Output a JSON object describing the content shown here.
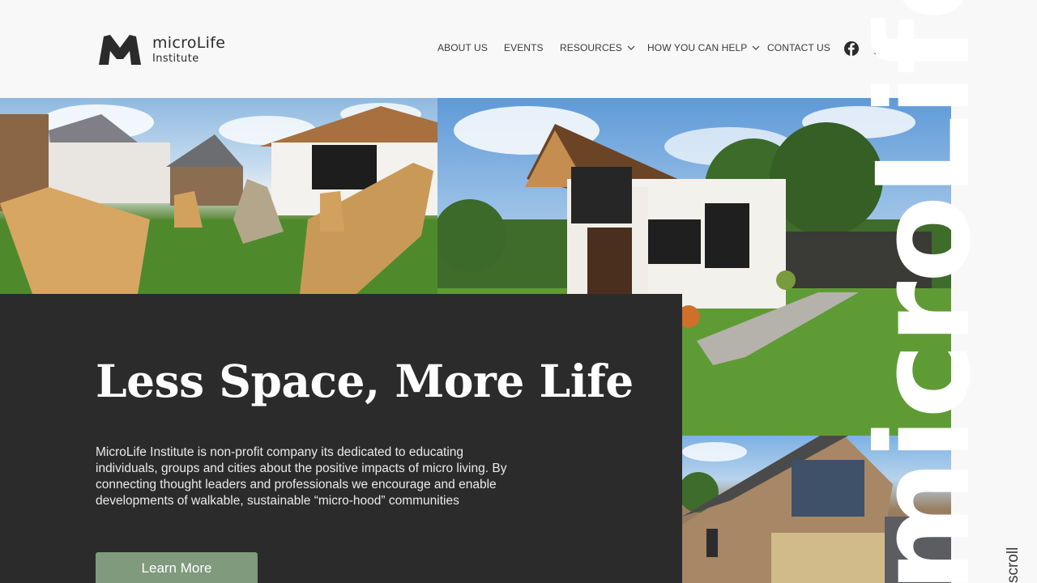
{
  "header": {
    "logo": {
      "line1": "microLife",
      "line2": "Institute",
      "brand_color": "#2b2b2b"
    },
    "nav": [
      {
        "label": "ABOUT US",
        "has_dropdown": false
      },
      {
        "label": "EVENTS",
        "has_dropdown": false
      },
      {
        "label": "RESOURCES",
        "has_dropdown": true
      },
      {
        "label": "HOW YOU CAN HELP",
        "has_dropdown": true
      },
      {
        "label": "CONTACT US",
        "has_dropdown": false
      }
    ],
    "social": [
      {
        "icon": "facebook-icon"
      },
      {
        "icon": "twitter-icon"
      },
      {
        "icon": "instagram-icon"
      },
      {
        "icon": "b-icon"
      }
    ]
  },
  "hero": {
    "headline": "Less Space, More Life",
    "intro": "MicroLife Institute is non-profit company its dedicated to educating individuals, groups and cities about the positive impacts of micro living. By connecting thought leaders and professionals we encourage and enable developments of walkable, sustainable “micro-hood” communities",
    "cta_label": "Learn More",
    "vertical_word": "microLife",
    "scroll_label": "scroll",
    "colors": {
      "panel": "#2b2b2b",
      "cta": "#7f9a7c",
      "page_bg": "#f8f8f8"
    }
  }
}
